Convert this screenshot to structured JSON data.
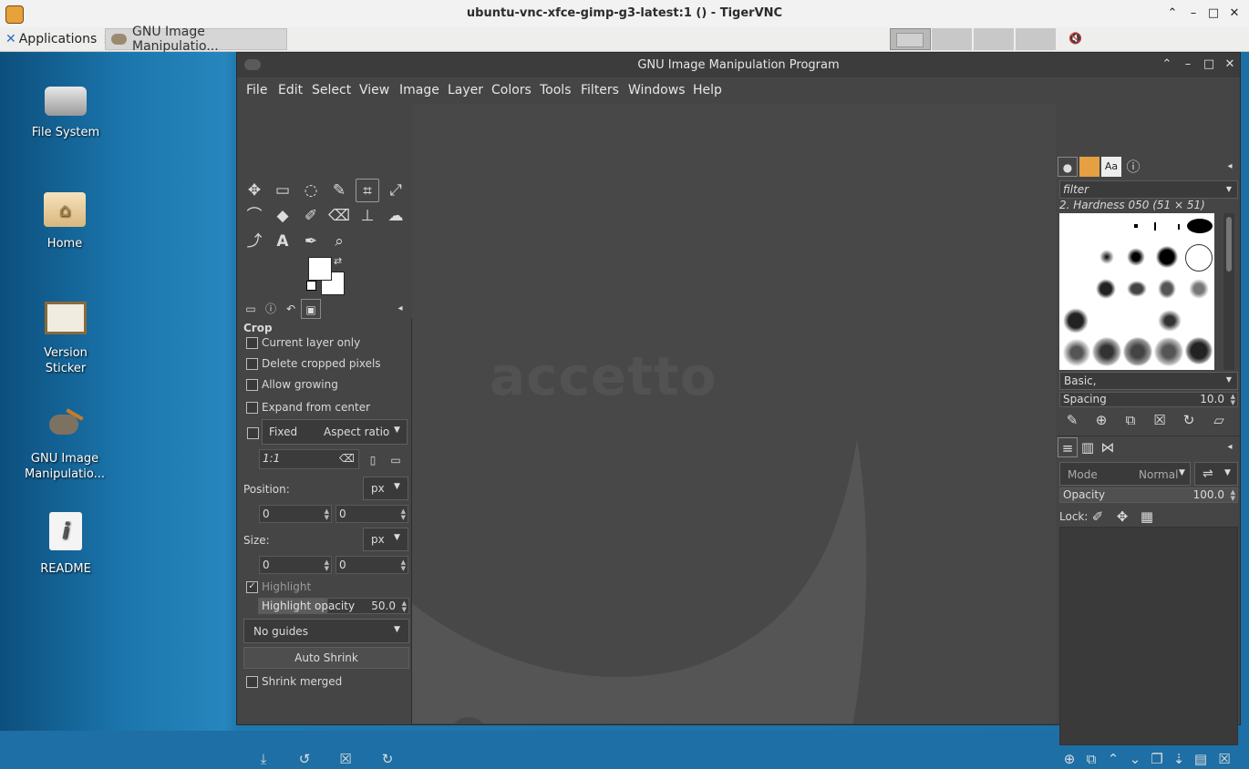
{
  "vnc": {
    "title": "ubuntu-vnc-xfce-gimp-g3-latest:1 () - TigerVNC"
  },
  "panel": {
    "applications_label": "Applications",
    "task_label": "GNU Image Manipulatio..."
  },
  "desktop_icons": [
    {
      "label": "File System"
    },
    {
      "label": "Home"
    },
    {
      "label": "Version Sticker"
    },
    {
      "label": "GNU Image Manipulatio..."
    },
    {
      "label": "README"
    }
  ],
  "gimp": {
    "title": "GNU Image Manipulation Program",
    "menu": [
      "File",
      "Edit",
      "Select",
      "View",
      "Image",
      "Layer",
      "Colors",
      "Tools",
      "Filters",
      "Windows",
      "Help"
    ],
    "watermark": "accetto",
    "tool_options": {
      "heading": "Crop",
      "current_layer_only": "Current layer only",
      "delete_cropped": "Delete cropped pixels",
      "allow_growing": "Allow growing",
      "expand_center": "Expand from center",
      "fixed": "Fixed",
      "aspect_ratio": "Aspect ratio",
      "ratio_value": "1:1",
      "position_label": "Position:",
      "position_unit": "px",
      "position_x": "0",
      "position_y": "0",
      "size_label": "Size:",
      "size_unit": "px",
      "size_x": "0",
      "size_y": "0",
      "highlight": "Highlight",
      "highlight_opacity_label": "Highlight opacity",
      "highlight_opacity_value": "50.0",
      "guides": "No guides",
      "auto_shrink": "Auto Shrink",
      "shrink_merged": "Shrink merged"
    },
    "brushes": {
      "filter_placeholder": "filter",
      "selected": "2. Hardness 050 (51 × 51)",
      "tag": "Basic,",
      "spacing_label": "Spacing",
      "spacing_value": "10.0"
    },
    "layers": {
      "mode_label": "Mode",
      "mode_value": "Normal",
      "opacity_label": "Opacity",
      "opacity_value": "100.0",
      "lock_label": "Lock:"
    }
  }
}
